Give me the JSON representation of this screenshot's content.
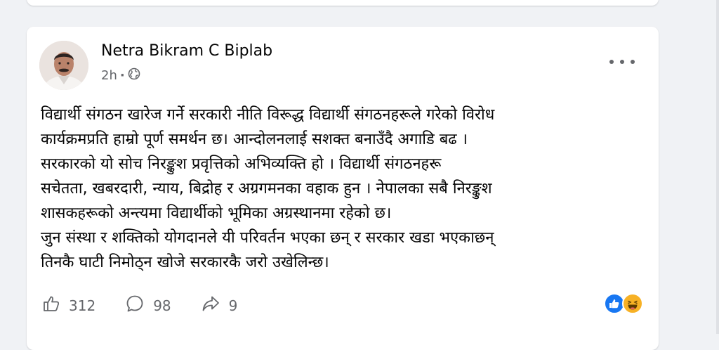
{
  "post": {
    "author": "Netra Bikram C Biplab",
    "time": "2h",
    "separator": "·",
    "audience_icon": "globe-icon",
    "more_icon": "more-options-icon",
    "lines": [
      "विद्यार्थी संगठन खारेज गर्ने  सरकारी नीति विरूद्ध विद्यार्थी संगठनहरूले गरेको विरोध",
      "कार्यक्रमप्रति हाम्रो पूर्ण समर्थन छ। आन्दोलनलाई सशक्त बनाउँदै अगाडि बढ ।",
      "सरकारको यो सोच निरङ्कुश प्रवृत्तिको अभिव्यक्ति हो । विद्यार्थी संगठनहरू",
      "सचेतता, खबरदारी, न्याय, बिद्रोह र अग्रगमनका वहाक हुन । नेपालका सबै निरङ्कुश",
      "शासकहरूको अन्त्यमा विद्यार्थीको भूमिका अग्रस्थानमा रहेको छ।",
      "जुन संस्था र शक्तिको योगदानले यी परिवर्तन भएका छन् र सरकार खडा भएकाछन्",
      "तिनकै घाटी निमोठ्न खोजे सरकारकै जरो उखेलिन्छ।"
    ]
  },
  "actions": {
    "like": {
      "icon": "like-icon",
      "count": "312"
    },
    "comment": {
      "icon": "comment-icon",
      "count": "98"
    },
    "share": {
      "icon": "share-icon",
      "count": "9"
    }
  },
  "reactions": {
    "icons": [
      "like-reaction-icon",
      "haha-reaction-icon"
    ],
    "like_color": "#1877f2",
    "haha_color": "#f7b125"
  },
  "colors": {
    "background": "#f0f2f5",
    "card": "#ffffff",
    "text": "#050505",
    "secondary": "#65676b"
  }
}
